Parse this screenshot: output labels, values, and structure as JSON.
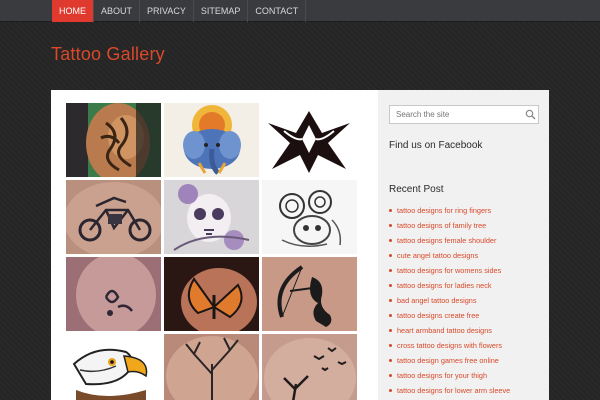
{
  "nav": {
    "items": [
      {
        "label": "HOME",
        "active": true
      },
      {
        "label": "ABOUT",
        "active": false
      },
      {
        "label": "PRIVACY",
        "active": false
      },
      {
        "label": "SITEMAP",
        "active": false
      },
      {
        "label": "CONTACT",
        "active": false
      }
    ]
  },
  "site": {
    "title": "Tattoo Gallery"
  },
  "gallery": {
    "thumbnails": [
      {
        "subject": "tribal-arm-tattoo"
      },
      {
        "subject": "elephant-ganesha-tattoo"
      },
      {
        "subject": "tribal-symmetric-design"
      },
      {
        "subject": "motorcycle-back-tattoo"
      },
      {
        "subject": "skull-flower-tattoo"
      },
      {
        "subject": "roses-sketch-tattoo"
      },
      {
        "subject": "small-back-tattoo"
      },
      {
        "subject": "butterfly-tattoo"
      },
      {
        "subject": "archer-silhouette-tattoo"
      },
      {
        "subject": "eagle-head-tattoo"
      },
      {
        "subject": "tree-back-tattoo"
      },
      {
        "subject": "birds-tree-tattoo"
      }
    ]
  },
  "sidebar": {
    "search_placeholder": "Search the site",
    "facebook_heading": "Find us on Facebook",
    "recent_heading": "Recent Post",
    "recent_posts": [
      "tattoo designs for ring fingers",
      "tattoo designs of family tree",
      "tattoo designs female shoulder",
      "cute angel tattoo designs",
      "tattoo designs for womens sides",
      "tattoo designs for ladies neck",
      "bad angel tattoo designs",
      "tattoo designs create free",
      "heart armband tattoo designs",
      "cross tattoo designs with flowers",
      "tattoo design games free online",
      "tattoo designs for your thigh",
      "tattoo designs for lower arm sleeve"
    ]
  },
  "colors": {
    "accent": "#d9492a",
    "nav_active": "#e03a2f",
    "background": "#262626"
  }
}
